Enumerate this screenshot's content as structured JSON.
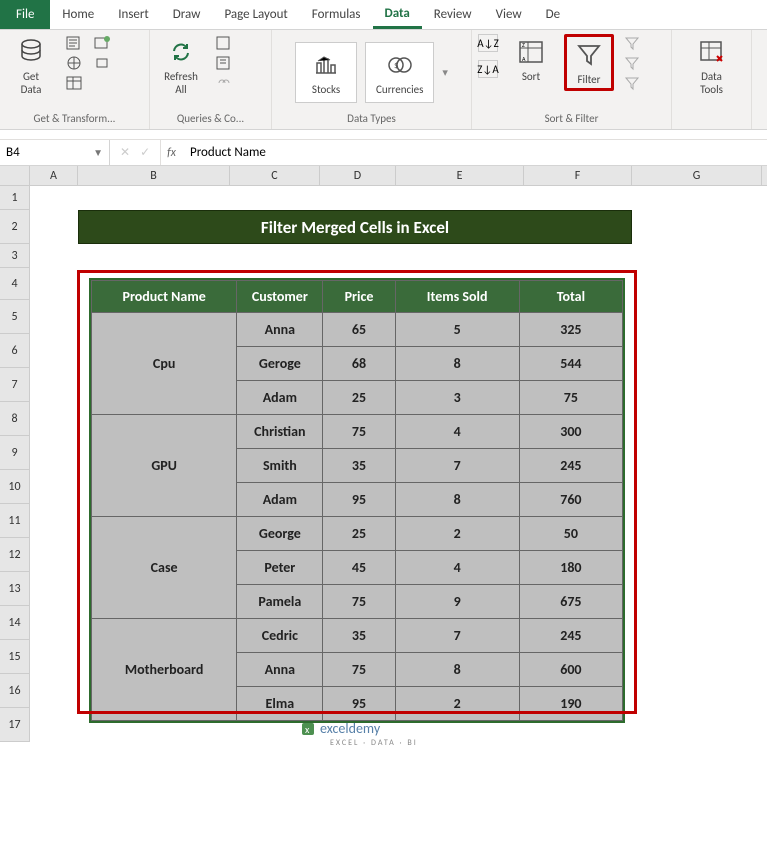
{
  "tabs": {
    "file": "File",
    "home": "Home",
    "insert": "Insert",
    "draw": "Draw",
    "pagelayout": "Page Layout",
    "formulas": "Formulas",
    "data": "Data",
    "review": "Review",
    "view": "View",
    "de": "De"
  },
  "ribbon": {
    "getdata": "Get\nData",
    "refresh": "Refresh\nAll",
    "stocks": "Stocks",
    "currencies": "Currencies",
    "sortAZ": "A→Z",
    "sortZA": "Z→A",
    "sort": "Sort",
    "filter": "Filter",
    "datatools": "Data\nTools",
    "grp_get": "Get & Transform...",
    "grp_queries": "Queries & Co...",
    "grp_types": "Data Types",
    "grp_sort": "Sort & Filter"
  },
  "namebox": "B4",
  "formula": "Product Name",
  "cols": {
    "A": "A",
    "B": "B",
    "C": "C",
    "D": "D",
    "E": "E",
    "F": "F",
    "G": "G"
  },
  "title": "Filter Merged Cells in Excel",
  "headers": [
    "Product Name",
    "Customer",
    "Price",
    "Items Sold",
    "Total"
  ],
  "data": [
    {
      "product": "Cpu",
      "rows": [
        {
          "customer": "Anna",
          "price": 65,
          "items": 5,
          "total": 325
        },
        {
          "customer": "Geroge",
          "price": 68,
          "items": 8,
          "total": 544
        },
        {
          "customer": "Adam",
          "price": 25,
          "items": 3,
          "total": 75
        }
      ]
    },
    {
      "product": "GPU",
      "rows": [
        {
          "customer": "Christian",
          "price": 75,
          "items": 4,
          "total": 300
        },
        {
          "customer": "Smith",
          "price": 35,
          "items": 7,
          "total": 245
        },
        {
          "customer": "Adam",
          "price": 95,
          "items": 8,
          "total": 760
        }
      ]
    },
    {
      "product": "Case",
      "rows": [
        {
          "customer": "George",
          "price": 25,
          "items": 2,
          "total": 50
        },
        {
          "customer": "Peter",
          "price": 45,
          "items": 4,
          "total": 180
        },
        {
          "customer": "Pamela",
          "price": 75,
          "items": 9,
          "total": 675
        }
      ]
    },
    {
      "product": "Motherboard",
      "rows": [
        {
          "customer": "Cedric",
          "price": 35,
          "items": 7,
          "total": 245
        },
        {
          "customer": "Anna",
          "price": 75,
          "items": 8,
          "total": 600
        },
        {
          "customer": "Elma",
          "price": 95,
          "items": 2,
          "total": 190
        }
      ]
    }
  ],
  "watermark": "exceldemy",
  "watermark_sub": "EXCEL · DATA · BI"
}
